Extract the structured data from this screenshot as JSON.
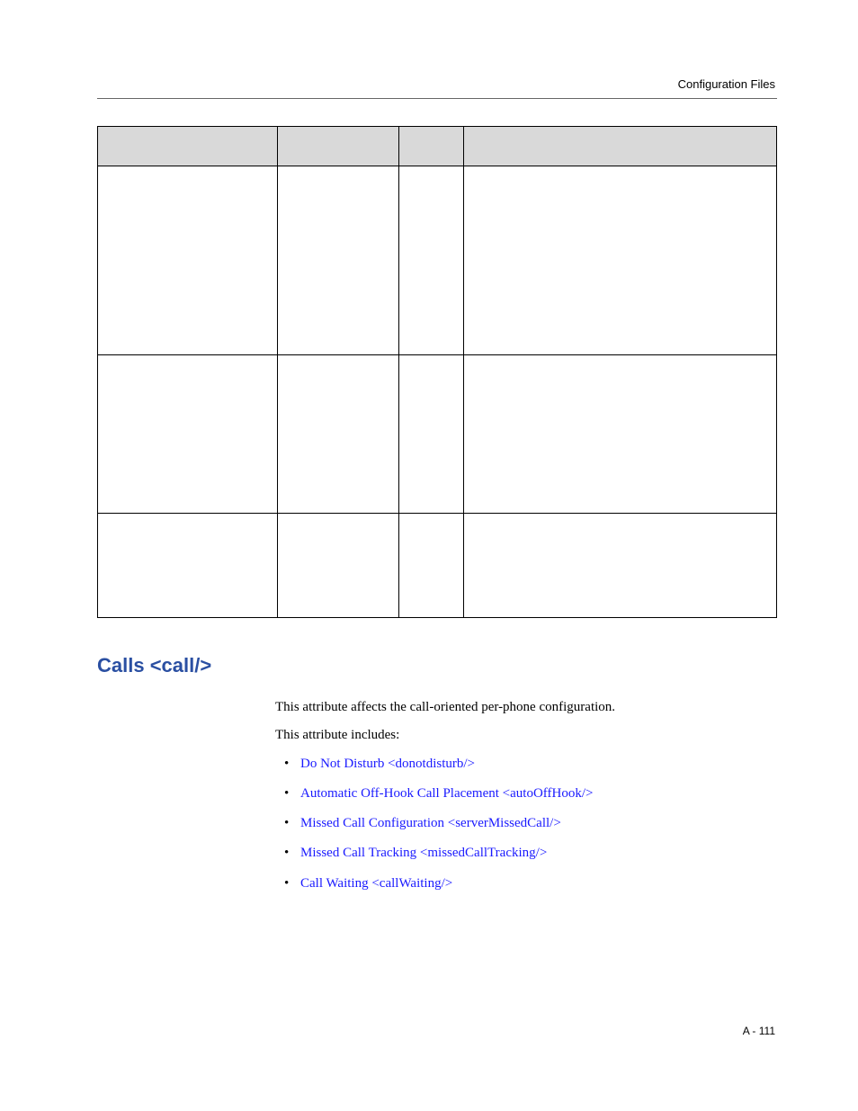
{
  "header": {
    "running_head": "Configuration Files"
  },
  "table": {
    "headers": {
      "attr": "",
      "perm": "",
      "def": "",
      "int": ""
    }
  },
  "section": {
    "heading": "Calls <call/>",
    "intro_1": "This attribute affects the call-oriented per-phone configuration.",
    "intro_2": "This attribute includes:",
    "links": [
      "Do Not Disturb <donotdisturb/>",
      "Automatic Off-Hook Call Placement <autoOffHook/>",
      "Missed Call Configuration <serverMissedCall/>",
      "Missed Call Tracking <missedCallTracking/>",
      "Call Waiting <callWaiting/>"
    ]
  },
  "footer": {
    "page_number": "A - 111"
  }
}
